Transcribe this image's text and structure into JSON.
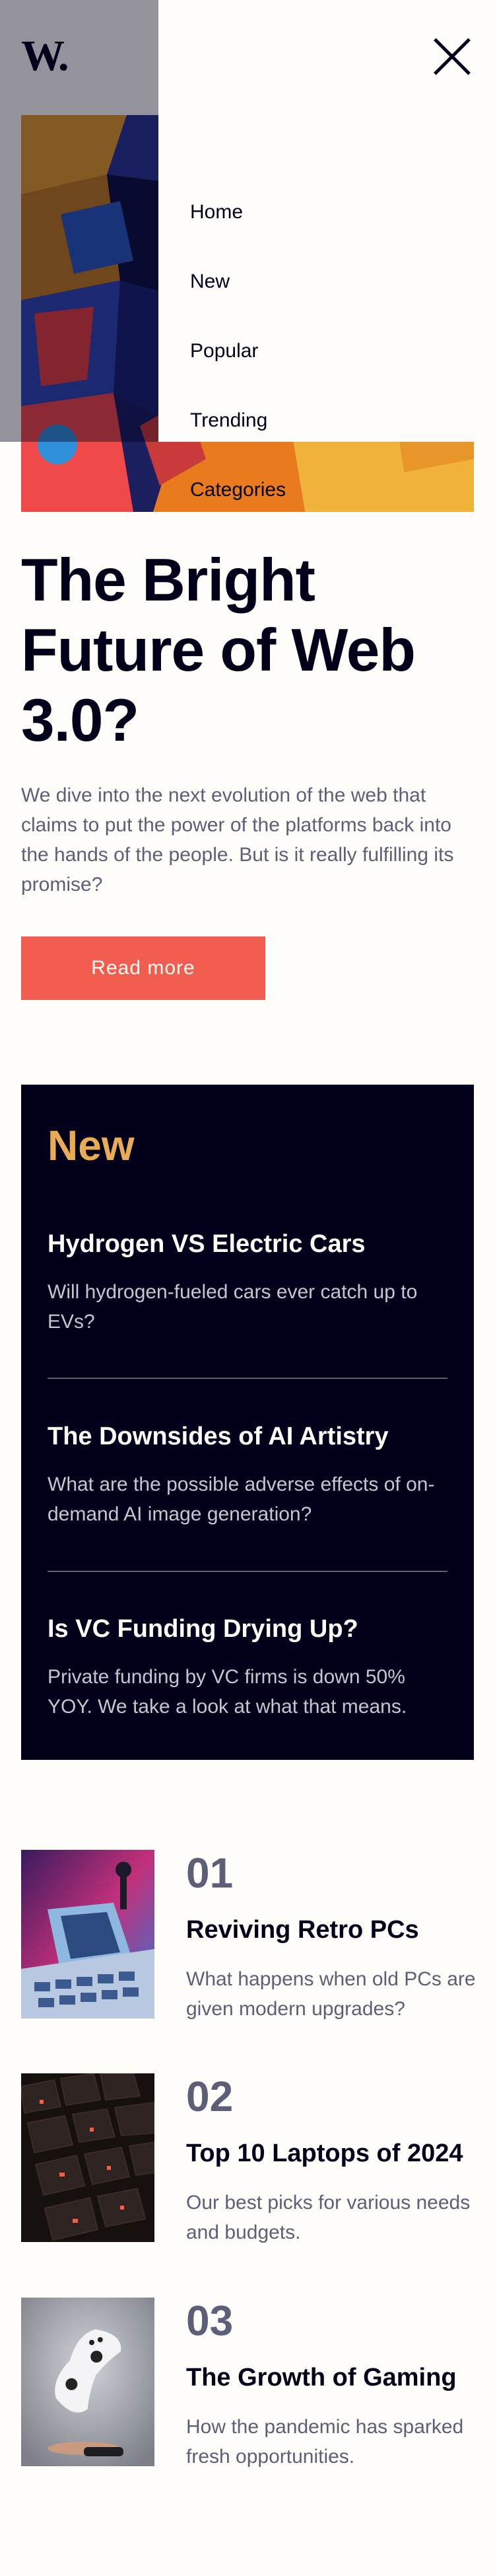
{
  "header": {
    "logo": "W."
  },
  "menu": {
    "items": [
      "Home",
      "New",
      "Popular",
      "Trending",
      "Categories"
    ]
  },
  "hero": {
    "title": "The Bright Future of Web 3.0?",
    "description": "We dive into the next evolution of the web that claims to put the power of the platforms back into the hands of the people. But is it really fulfilling its promise?",
    "button_label": "Read more"
  },
  "new_section": {
    "heading": "New",
    "items": [
      {
        "title": "Hydrogen VS Electric Cars",
        "text": "Will hydrogen-fueled cars ever catch up to EVs?"
      },
      {
        "title": "The Downsides of AI Artistry",
        "text": "What are the possible adverse effects of on-demand AI image generation?"
      },
      {
        "title": "Is VC Funding Drying Up?",
        "text": "Private funding by VC firms is down 50% YOY. We take a look at what that means."
      }
    ]
  },
  "numbered": [
    {
      "number": "01",
      "title": "Reviving Retro PCs",
      "text": "What happens when old PCs are given modern upgrades?",
      "image": "retro-pc-image"
    },
    {
      "number": "02",
      "title": "Top 10 Laptops of 2024",
      "text": "Our best picks for various needs and budgets.",
      "image": "laptop-keyboard-image"
    },
    {
      "number": "03",
      "title": "The Growth of Gaming",
      "text": "How the pandemic has sparked fresh opportunities.",
      "image": "game-controller-image"
    }
  ],
  "colors": {
    "background": "#fffdf9",
    "dark_navy": "#00001a",
    "accent_red": "#f15e50",
    "accent_orange": "#e9ab53",
    "grayish_blue": "#5d5f79"
  }
}
